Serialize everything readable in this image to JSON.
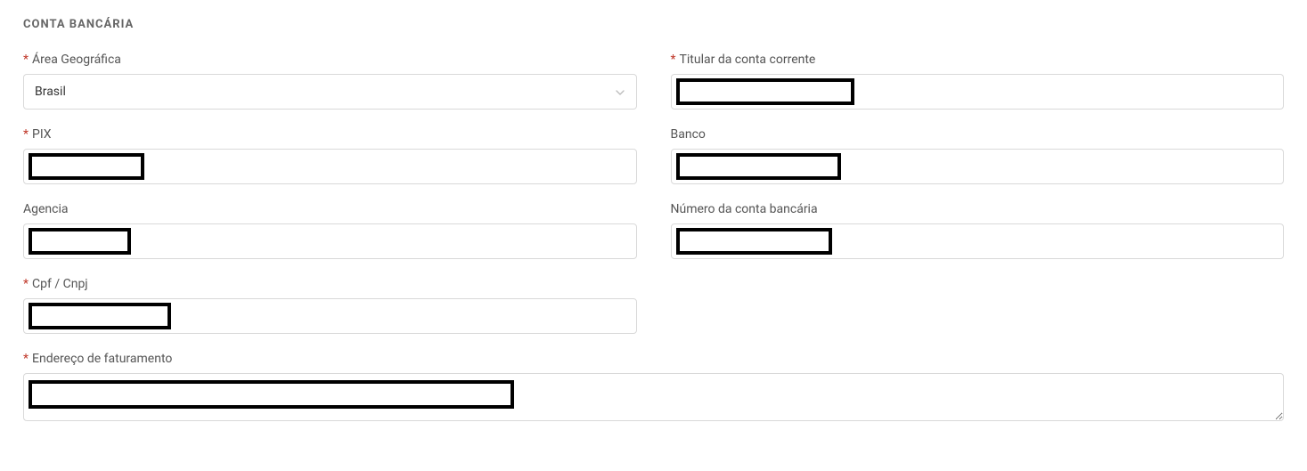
{
  "section_title": "CONTA BANCÁRIA",
  "fields": {
    "area_geografica": {
      "label": "Área Geográfica",
      "required": true,
      "value": "Brasil"
    },
    "titular": {
      "label": "Titular da conta corrente",
      "required": true,
      "value": ""
    },
    "pix": {
      "label": "PIX",
      "required": true,
      "value": ""
    },
    "banco": {
      "label": "Banco",
      "required": false,
      "value": ""
    },
    "agencia": {
      "label": "Agencia",
      "required": false,
      "value": ""
    },
    "numero_conta": {
      "label": "Número da conta bancária",
      "required": false,
      "value": ""
    },
    "cpf_cnpj": {
      "label": "Cpf / Cnpj",
      "required": true,
      "value": ""
    },
    "endereco_faturamento": {
      "label": "Endereço de faturamento",
      "required": true,
      "value": ""
    }
  },
  "required_marker": "*"
}
